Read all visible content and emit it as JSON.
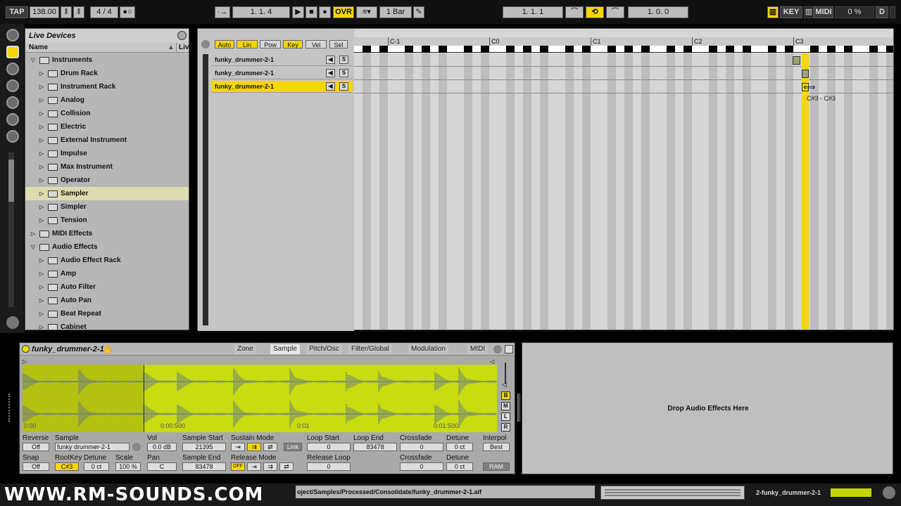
{
  "topbar": {
    "tap": "TAP",
    "tempo": "138.00",
    "sig_num": "4",
    "sig_sep": "/",
    "sig_den": "4",
    "arrangement_position": "1.   1.   4",
    "ovr": "OVR",
    "quantize": "1 Bar",
    "loop_start": "1.   1.   1",
    "loop_length": "1.   0.   0",
    "key": "KEY",
    "midi": "MIDI",
    "cpu": "0 %",
    "d": "D"
  },
  "browser": {
    "title": "Live Devices",
    "col_name": "Name",
    "col_live": "Liv",
    "items": [
      {
        "label": "Instruments",
        "level": 0,
        "open": true
      },
      {
        "label": "Drum Rack",
        "level": 1
      },
      {
        "label": "Instrument Rack",
        "level": 1
      },
      {
        "label": "Analog",
        "level": 1
      },
      {
        "label": "Collision",
        "level": 1
      },
      {
        "label": "Electric",
        "level": 1
      },
      {
        "label": "External Instrument",
        "level": 1
      },
      {
        "label": "Impulse",
        "level": 1
      },
      {
        "label": "Max Instrument",
        "level": 1
      },
      {
        "label": "Operator",
        "level": 1
      },
      {
        "label": "Sampler",
        "level": 1,
        "selected": true
      },
      {
        "label": "Simpler",
        "level": 1
      },
      {
        "label": "Tension",
        "level": 1
      },
      {
        "label": "MIDI Effects",
        "level": 0
      },
      {
        "label": "Audio Effects",
        "level": 0,
        "open": true
      },
      {
        "label": "Audio Effect Rack",
        "level": 1
      },
      {
        "label": "Amp",
        "level": 1
      },
      {
        "label": "Auto Filter",
        "level": 1
      },
      {
        "label": "Auto Pan",
        "level": 1
      },
      {
        "label": "Beat Repeat",
        "level": 1
      },
      {
        "label": "Cabinet",
        "level": 1
      }
    ]
  },
  "zones": {
    "mode_buttons": [
      "Auto",
      "Lin",
      "Pow",
      "Key",
      "Vel",
      "Sel"
    ],
    "mode_on": [
      "Auto",
      "Lin",
      "Key"
    ],
    "tracks": [
      "funky_drummer-2-1",
      "funky_drummer-2-1",
      "funky_drummer-2-1"
    ],
    "speaker_icon": "speaker-icon",
    "solo": "S",
    "ruler": [
      "C-1",
      "C0",
      "C1",
      "C2",
      "C3"
    ],
    "tooltip": "C#3 - C#3"
  },
  "device": {
    "name": "funky_drummer-2-1",
    "tabs": [
      "Zone",
      "Sample",
      "Pitch/Osc",
      "Filter/Global",
      "Modulation",
      "MIDI"
    ],
    "wave_times": [
      "0:00",
      "0:00:500",
      "0:01",
      "0:01:500"
    ],
    "side_buttons": [
      "B",
      "M",
      "L",
      "R"
    ],
    "params_row1": {
      "reverse_label": "Reverse",
      "reverse_value": "Off",
      "sample_label": "Sample",
      "sample_value": "funky drummer-2-1",
      "vol_label": "Vol",
      "vol_value": "0.0 dB",
      "sample_start_label": "Sample Start",
      "sample_start_value": "21395",
      "sustain_mode_label": "Sustain Mode",
      "link": "Link",
      "loop_start_label": "Loop Start",
      "loop_start_value": "0",
      "loop_end_label": "Loop End",
      "loop_end_value": "83478",
      "crossfade_label": "Crossfade",
      "crossfade_value": "0",
      "detune_label": "Detune",
      "detune_value": "0 ct",
      "interpol_label": "Interpol",
      "interpol_value": "Best"
    },
    "params_row2": {
      "snap_label": "Snap",
      "snap_value": "Off",
      "rootkey_label": "RootKey",
      "rootkey_value": "C#3",
      "detune_label": "Detune",
      "detune_value": "0 ct",
      "scale_label": "Scale",
      "scale_value": "100 %",
      "pan_label": "Pan",
      "pan_value": "C",
      "sample_end_label": "Sample End",
      "sample_end_value": "83478",
      "release_mode_label": "Release Mode",
      "release_off": "OFF",
      "release_loop_label": "Release Loop",
      "release_loop_value": "0",
      "crossfade_label": "Crossfade",
      "crossfade_value": "0",
      "detune2_label": "Detune",
      "detune2_value": "0 ct",
      "ram": "RAM"
    }
  },
  "fx": {
    "drop_text": "Drop Audio Effects Here"
  },
  "status": {
    "logo": "WWW.RM-SOUNDS.COM",
    "path": "oject/Samples/Processed/Consolidate/funky_drummer-2-1.aif",
    "clip": "2-funky_drummer-2-1"
  }
}
